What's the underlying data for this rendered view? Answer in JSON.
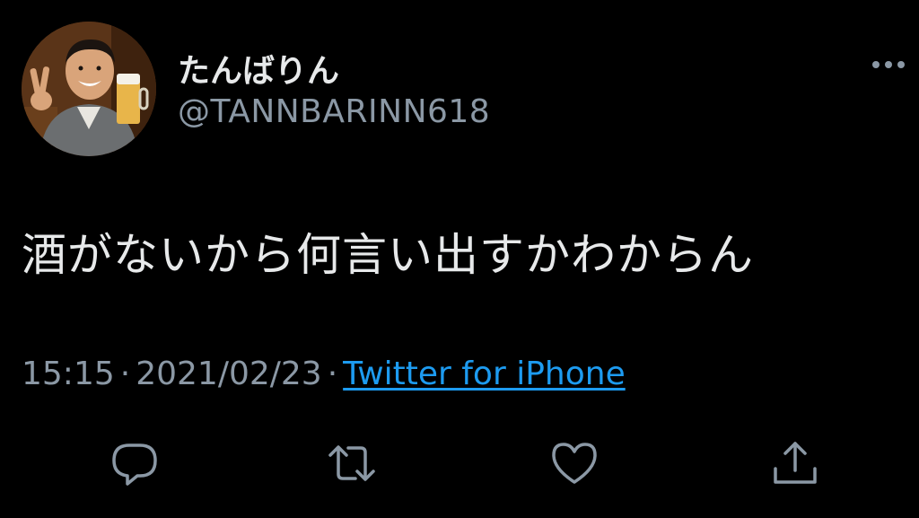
{
  "user": {
    "display_name": "たんばりん",
    "handle": "@TANNBARINN618",
    "avatar_icon": "profile-photo"
  },
  "tweet": {
    "text": "酒がないから何言い出すかわからん",
    "time": "15:15",
    "separator": "·",
    "date": "2021/02/23",
    "source": "Twitter for iPhone"
  },
  "actions": [
    "reply-icon",
    "retweet-icon",
    "like-icon",
    "share-icon"
  ],
  "colors": {
    "background": "#000000",
    "primary_text": "#e7e9ea",
    "secondary_text": "#8b98a5",
    "link": "#1d9bf0"
  }
}
